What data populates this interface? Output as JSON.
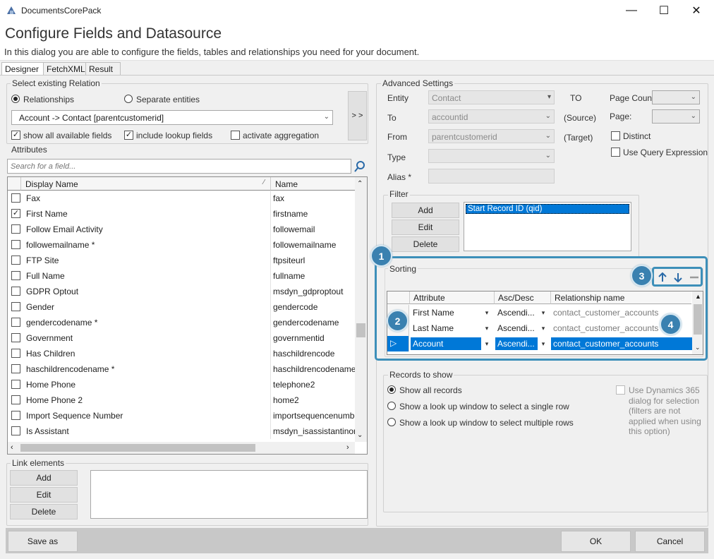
{
  "window": {
    "app_title": "DocumentsCorePack",
    "heading": "Configure Fields and Datasource",
    "subtitle": "In this dialog you are able to configure the fields, tables and relationships you need for your document."
  },
  "tabs": [
    {
      "label": "Designer"
    },
    {
      "label": "FetchXML"
    },
    {
      "label": "Result"
    }
  ],
  "relation": {
    "group_label": "Select existing Relation",
    "radio_relationships": "Relationships",
    "radio_separate": "Separate entities",
    "selected_relation": "Account -> Contact   [parentcustomerid]",
    "side_btn": "> >",
    "chk_show_all": "show all available fields",
    "chk_include_lookup": "include lookup fields",
    "chk_activate_agg": "activate aggregation"
  },
  "attributes": {
    "group_label": "Attributes",
    "search_placeholder": "Search for a field...",
    "col_display": "Display Name",
    "col_name": "Name",
    "rows": [
      {
        "display": "Fax",
        "name": "fax",
        "checked": false
      },
      {
        "display": "First Name",
        "name": "firstname",
        "checked": true
      },
      {
        "display": "Follow Email Activity",
        "name": "followemail",
        "checked": false
      },
      {
        "display": "followemailname *",
        "name": "followemailname",
        "checked": false
      },
      {
        "display": "FTP Site",
        "name": "ftpsiteurl",
        "checked": false
      },
      {
        "display": "Full Name",
        "name": "fullname",
        "checked": false
      },
      {
        "display": "GDPR Optout",
        "name": "msdyn_gdproptout",
        "checked": false
      },
      {
        "display": "Gender",
        "name": "gendercode",
        "checked": false
      },
      {
        "display": "gendercodename *",
        "name": "gendercodename",
        "checked": false
      },
      {
        "display": "Government",
        "name": "governmentid",
        "checked": false
      },
      {
        "display": "Has Children",
        "name": "haschildrencode",
        "checked": false
      },
      {
        "display": "haschildrencodename *",
        "name": "haschildrencodename",
        "checked": false
      },
      {
        "display": "Home Phone",
        "name": "telephone2",
        "checked": false
      },
      {
        "display": "Home Phone 2",
        "name": "home2",
        "checked": false
      },
      {
        "display": "Import Sequence Number",
        "name": "importsequencenumbe",
        "checked": false
      },
      {
        "display": "Is Assistant",
        "name": "msdyn_isassistantinorg",
        "checked": false
      }
    ]
  },
  "link_elements": {
    "group_label": "Link elements",
    "add": "Add",
    "edit": "Edit",
    "delete": "Delete"
  },
  "advanced": {
    "group_label": "Advanced Settings",
    "entity_label": "Entity",
    "entity_value": "Contact",
    "to_label": "To",
    "to_value": "accountid",
    "from_label": "From",
    "from_value": "parentcustomerid",
    "type_label": "Type",
    "alias_label": "Alias *",
    "to_caption": "TO",
    "source_caption": "(Source)",
    "target_caption": "(Target)",
    "page_count_label": "Page Count:",
    "page_label": "Page:",
    "distinct_label": "Distinct",
    "use_query_label": "Use Query Expression"
  },
  "filter": {
    "group_label": "Filter",
    "add": "Add",
    "edit": "Edit",
    "delete": "Delete",
    "items": [
      "Start Record ID (qid)"
    ]
  },
  "sorting": {
    "group_label": "Sorting",
    "col_attribute": "Attribute",
    "col_ascdesc": "Asc/Desc",
    "col_relationship": "Relationship name",
    "rows": [
      {
        "attribute": "First Name",
        "order": "Ascendi...",
        "relationship": "contact_customer_accounts"
      },
      {
        "attribute": "Last Name",
        "order": "Ascendi...",
        "relationship": "contact_customer_accounts"
      },
      {
        "attribute": "Account",
        "order": "Ascendi...",
        "relationship": "contact_customer_accounts"
      }
    ],
    "callouts": [
      "1",
      "2",
      "3",
      "4"
    ]
  },
  "records": {
    "group_label": "Records to show",
    "opt_all": "Show all records",
    "opt_single": "Show a look up window to select a single row",
    "opt_multiple": "Show a look up window to select multiple rows",
    "dynamics_label": "Use Dynamics 365 dialog for selection (filters are not applied when using this option)"
  },
  "footer": {
    "save_as": "Save as",
    "ok": "OK",
    "cancel": "Cancel"
  },
  "colors": {
    "accent": "#3a81b0",
    "selection": "#0078d7"
  }
}
